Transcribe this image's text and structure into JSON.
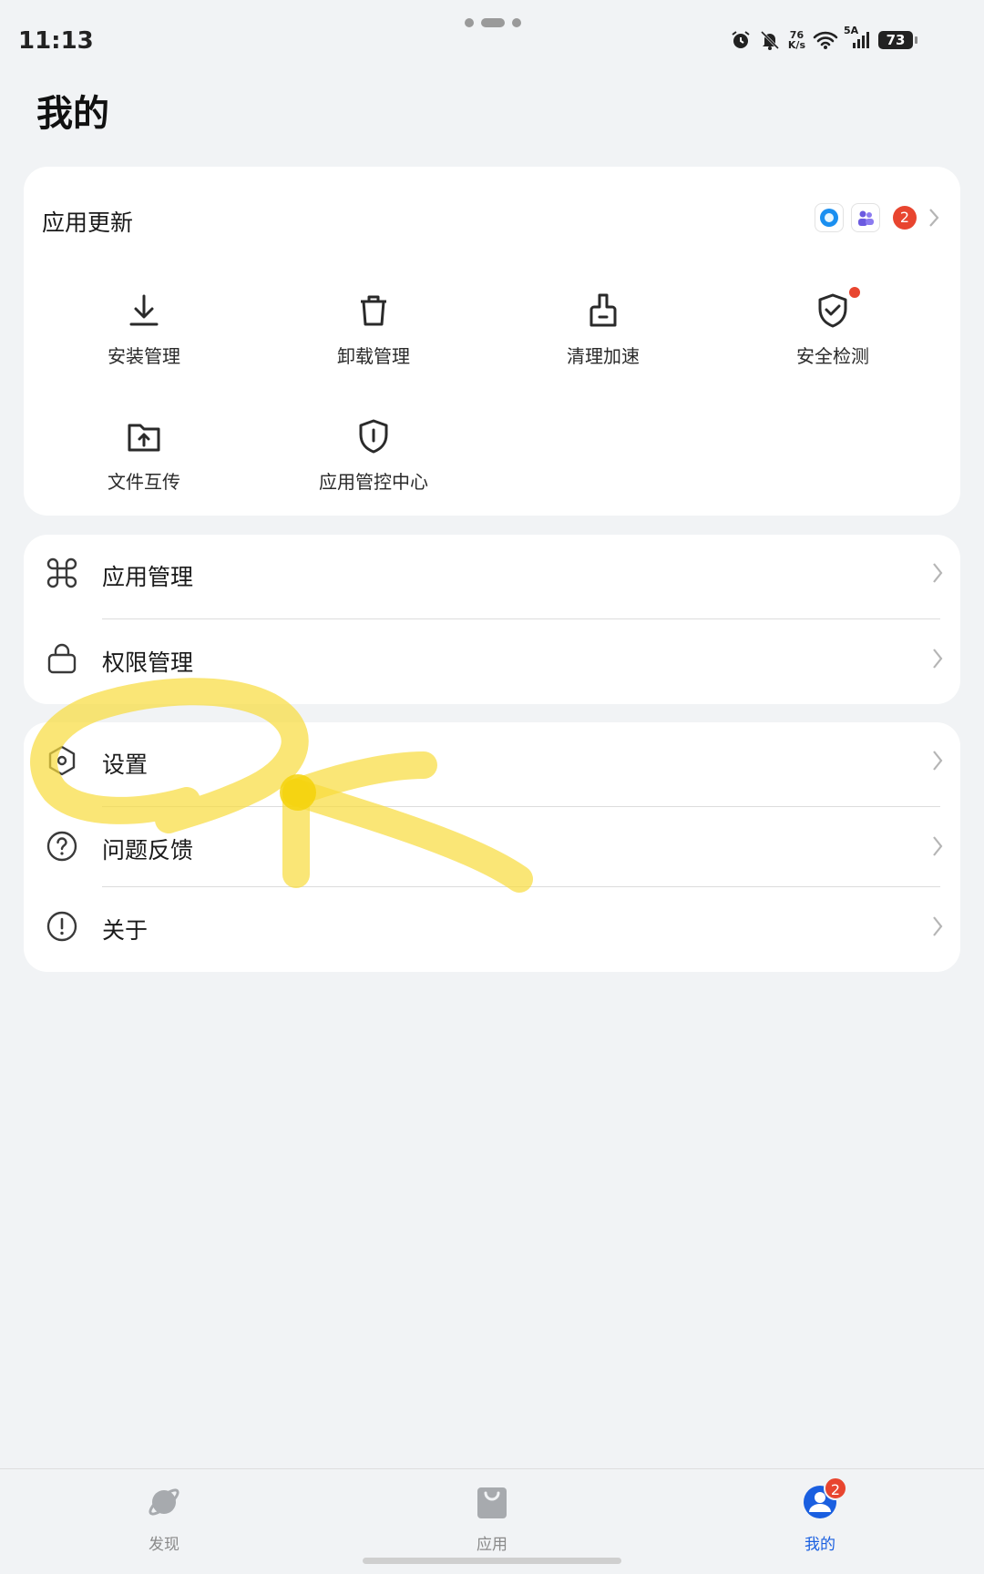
{
  "status_bar": {
    "time": "11:13",
    "net_speed_value": "76",
    "net_speed_unit": "K/s",
    "cell_label": "5A",
    "battery": "73"
  },
  "page_title": "我的",
  "app_update": {
    "title": "应用更新",
    "badge_count": "2"
  },
  "tools": [
    {
      "label": "安装管理",
      "icon": "download-icon"
    },
    {
      "label": "卸载管理",
      "icon": "trash-icon"
    },
    {
      "label": "清理加速",
      "icon": "brush-icon"
    },
    {
      "label": "安全检测",
      "icon": "shield-check-icon"
    },
    {
      "label": "文件互传",
      "icon": "folder-upload-icon"
    },
    {
      "label": "应用管控中心",
      "icon": "shield-info-icon"
    }
  ],
  "manage_list": [
    {
      "label": "应用管理",
      "icon": "command-icon"
    },
    {
      "label": "权限管理",
      "icon": "lock-icon"
    }
  ],
  "misc_list": [
    {
      "label": "设置",
      "icon": "settings-hex-icon"
    },
    {
      "label": "问题反馈",
      "icon": "help-circle-icon"
    },
    {
      "label": "关于",
      "icon": "info-exclaim-icon"
    }
  ],
  "tabbar": {
    "items": [
      {
        "label": "发现",
        "icon": "planet-icon"
      },
      {
        "label": "应用",
        "icon": "shopping-bag-icon"
      },
      {
        "label": "我的",
        "icon": "user-icon",
        "badge": "2"
      }
    ],
    "active_color": "#1a5fe0"
  },
  "colors": {
    "accent_red": "#e8452f",
    "highlight_yellow": "#f8dc3c"
  }
}
